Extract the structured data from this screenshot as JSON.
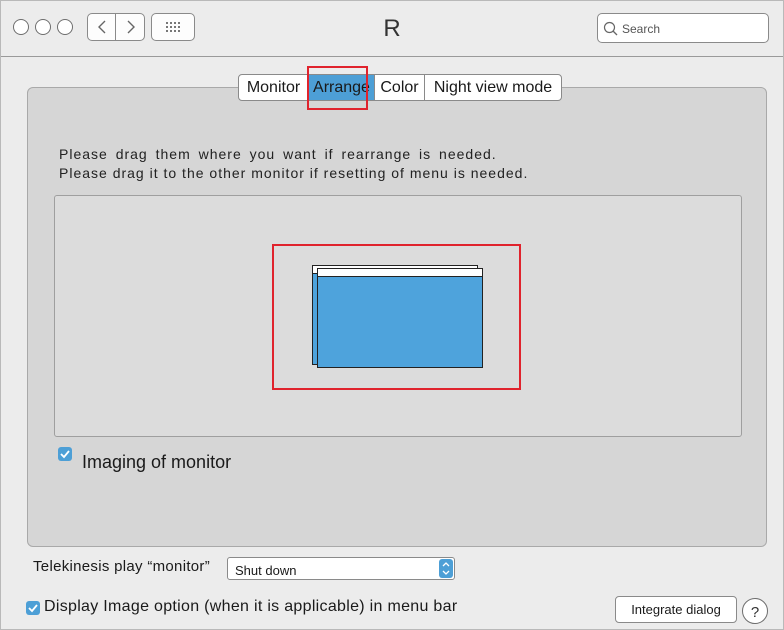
{
  "window": {
    "title": "R"
  },
  "titlebar": {
    "traffic_lights": [
      "close",
      "minimize",
      "zoom"
    ],
    "back_icon": "chevron-left-icon",
    "forward_icon": "chevron-right-icon",
    "grid_icon": "grid-icon",
    "search": {
      "placeholder": "Search",
      "icon": "search-icon"
    }
  },
  "tabs": [
    {
      "label": "Monitor",
      "active": false
    },
    {
      "label": "Arrange",
      "active": true
    },
    {
      "label": "Color",
      "active": false
    },
    {
      "label": "Night view mode",
      "active": false
    }
  ],
  "arrange": {
    "instructions": [
      "Please drag them where you want if rearrange is needed.",
      "Please drag it to the other monitor if resetting of menu is needed."
    ],
    "monitor_color": "#4ea3dc"
  },
  "imaging": {
    "label": "Imaging of monitor",
    "checked": true
  },
  "telekinesis": {
    "label": "Telekinesis play “monitor”",
    "selected": "Shut down"
  },
  "display_option": {
    "label": "Display Image option (when it is applicable) in menu bar",
    "checked": true
  },
  "buttons": {
    "integrate": "Integrate dialog",
    "help": "?"
  },
  "colors": {
    "accent": "#4d9fd6",
    "highlight": "#e0232d",
    "panel": "#d6d6d6"
  }
}
